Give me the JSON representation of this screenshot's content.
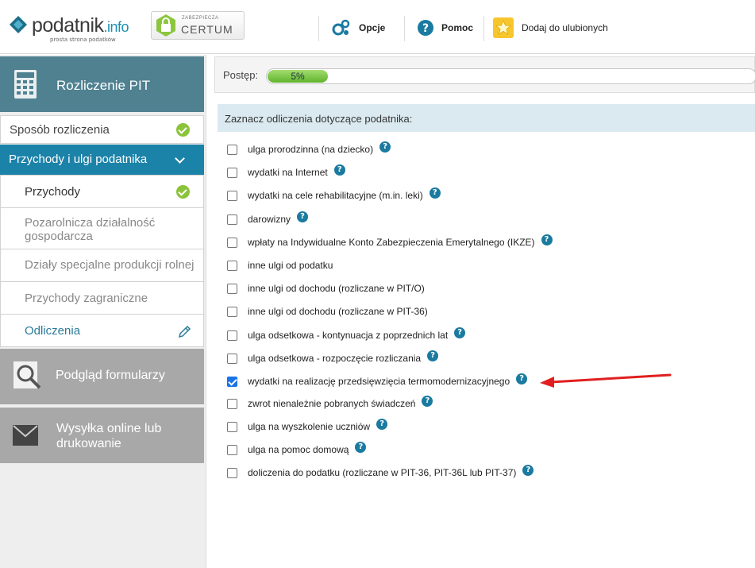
{
  "header": {
    "logo_text": "podatnik",
    "logo_ext": ".info",
    "logo_tagline": "prosta strona podatków",
    "certum_small": "ZABEZPIECZA",
    "certum_big": "CERTUM",
    "buttons": [
      {
        "label": "Opcje",
        "icon": "options-icon"
      },
      {
        "label": "Pomoc",
        "icon": "help-icon"
      },
      {
        "label": "Dodaj do ulubionych",
        "icon": "star-icon"
      }
    ]
  },
  "sidebar": {
    "title": "Rozliczenie PIT",
    "sposob": "Sposób rozliczenia",
    "category": "Przychody i ulgi podatnika",
    "sub_items": [
      {
        "label": "Przychody",
        "state": "done"
      },
      {
        "label": "Pozarolnicza działalność gospodarcza",
        "state": "idle"
      },
      {
        "label": "Działy specjalne produkcji rolnej",
        "state": "idle"
      },
      {
        "label": "Przychody zagraniczne",
        "state": "idle"
      },
      {
        "label": "Odliczenia",
        "state": "active"
      }
    ],
    "preview": "Podgląd formularzy",
    "send": "Wysyłka online lub drukowanie"
  },
  "progress": {
    "label": "Postęp:",
    "value_text": "5%",
    "value": 0.05
  },
  "section": {
    "title": "Zaznacz odliczenia dotyczące podatnika:"
  },
  "options": [
    {
      "label": "ulga prorodzinna (na dziecko)",
      "checked": false,
      "help": true
    },
    {
      "label": "wydatki na Internet",
      "checked": false,
      "help": true
    },
    {
      "label": "wydatki na cele rehabilitacyjne (m.in. leki)",
      "checked": false,
      "help": true
    },
    {
      "label": "darowizny",
      "checked": false,
      "help": true
    },
    {
      "label": "wpłaty na Indywidualne Konto Zabezpieczenia Emerytalnego (IKZE)",
      "checked": false,
      "help": true
    },
    {
      "label": "inne ulgi od podatku",
      "checked": false,
      "help": false
    },
    {
      "label": "inne ulgi od dochodu (rozliczane w PIT/O)",
      "checked": false,
      "help": false
    },
    {
      "label": "inne ulgi od dochodu (rozliczane w PIT-36)",
      "checked": false,
      "help": false
    },
    {
      "label": "ulga odsetkowa - kontynuacja z poprzednich lat",
      "checked": false,
      "help": true
    },
    {
      "label": "ulga odsetkowa - rozpoczęcie rozliczania",
      "checked": false,
      "help": true
    },
    {
      "label": "wydatki na realizację przedsięwzięcia termomodernizacyjnego",
      "checked": true,
      "help": true
    },
    {
      "label": "zwrot nienależnie pobranych świadczeń",
      "checked": false,
      "help": true
    },
    {
      "label": "ulga na wyszkolenie uczniów",
      "checked": false,
      "help": true
    },
    {
      "label": "ulga na pomoc domową",
      "checked": false,
      "help": true
    },
    {
      "label": "doliczenia do podatku (rozliczane w PIT-36, PIT-36L lub PIT-37)",
      "checked": false,
      "help": true
    }
  ],
  "help_glyph": "?",
  "colors": {
    "sidebar_head": "#4f8191",
    "category": "#1b82a8",
    "check_green": "#8bc33a",
    "help_blue": "#1a7aa0",
    "arrow_red": "#e02020"
  }
}
